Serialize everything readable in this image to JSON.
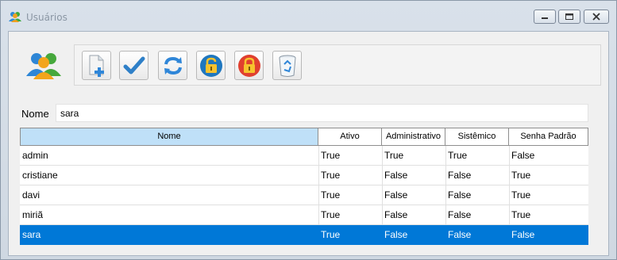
{
  "window": {
    "title": "Usuários"
  },
  "toolbar": {
    "buttons": [
      {
        "icon": "new-document-icon"
      },
      {
        "icon": "checkmark-icon"
      },
      {
        "icon": "refresh-icon"
      },
      {
        "icon": "unlock-icon"
      },
      {
        "icon": "lock-icon"
      },
      {
        "icon": "recycle-bin-icon"
      }
    ]
  },
  "filter": {
    "label": "Nome",
    "value": "sara"
  },
  "grid": {
    "columns": [
      "Nome",
      "Ativo",
      "Administrativo",
      "Sistêmico",
      "Senha Padrão"
    ],
    "rows": [
      [
        "admin",
        "True",
        "True",
        "True",
        "False"
      ],
      [
        "cristiane",
        "True",
        "False",
        "False",
        "True"
      ],
      [
        "davi",
        "True",
        "False",
        "False",
        "True"
      ],
      [
        "miriã",
        "True",
        "False",
        "False",
        "True"
      ],
      [
        "sara",
        "True",
        "False",
        "False",
        "False"
      ]
    ],
    "selected_row": 4
  },
  "colors": {
    "selection": "#0078d7",
    "header_sorted": "#bfe0f8",
    "title_text": "#8a96a4"
  }
}
